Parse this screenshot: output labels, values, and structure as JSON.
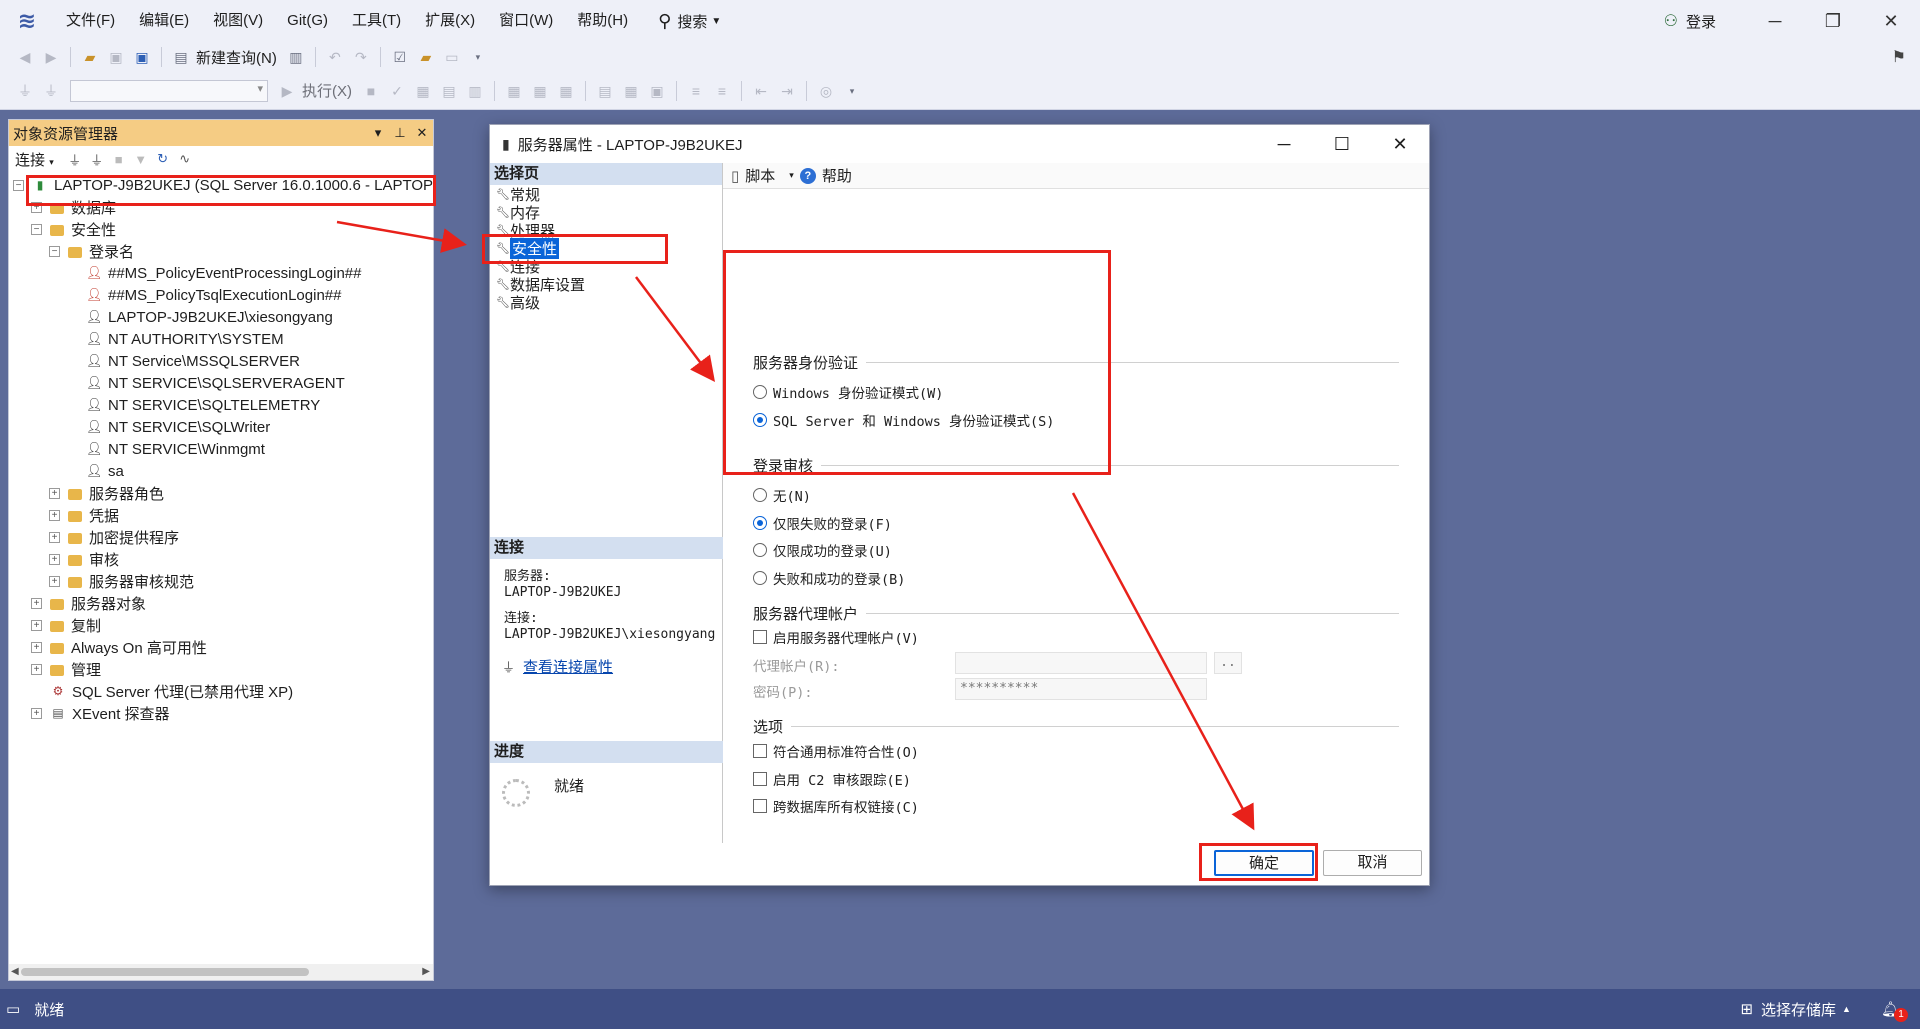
{
  "menubar": {
    "items": [
      "文件(F)",
      "编辑(E)",
      "视图(V)",
      "Git(G)",
      "工具(T)",
      "扩展(X)",
      "窗口(W)",
      "帮助(H)"
    ],
    "search_label": "搜索",
    "login_label": "登录"
  },
  "toolbar": {
    "new_query_label": "新建查询(N)",
    "execute_label": "执行(X)"
  },
  "object_explorer": {
    "title": "对象资源管理器",
    "connect_label": "连接",
    "tree": [
      {
        "level": 0,
        "expander": "−",
        "icon": "server-icon",
        "label": "LAPTOP-J9B2UKEJ (SQL Server 16.0.1000.6 - LAPTOP"
      },
      {
        "level": 1,
        "expander": "+",
        "icon": "folder-icon",
        "label": "数据库"
      },
      {
        "level": 1,
        "expander": "−",
        "icon": "folder-icon",
        "label": "安全性"
      },
      {
        "level": 2,
        "expander": "−",
        "icon": "folder-icon",
        "label": "登录名"
      },
      {
        "level": 3,
        "expander": "",
        "icon": "disabled-login-icon",
        "label": "##MS_PolicyEventProcessingLogin##"
      },
      {
        "level": 3,
        "expander": "",
        "icon": "disabled-login-icon",
        "label": "##MS_PolicyTsqlExecutionLogin##"
      },
      {
        "level": 3,
        "expander": "",
        "icon": "login-icon",
        "label": "LAPTOP-J9B2UKEJ\\xiesongyang"
      },
      {
        "level": 3,
        "expander": "",
        "icon": "login-icon",
        "label": "NT AUTHORITY\\SYSTEM"
      },
      {
        "level": 3,
        "expander": "",
        "icon": "login-icon",
        "label": "NT Service\\MSSQLSERVER"
      },
      {
        "level": 3,
        "expander": "",
        "icon": "login-icon",
        "label": "NT SERVICE\\SQLSERVERAGENT"
      },
      {
        "level": 3,
        "expander": "",
        "icon": "login-icon",
        "label": "NT SERVICE\\SQLTELEMETRY"
      },
      {
        "level": 3,
        "expander": "",
        "icon": "login-icon",
        "label": "NT SERVICE\\SQLWriter"
      },
      {
        "level": 3,
        "expander": "",
        "icon": "login-icon",
        "label": "NT SERVICE\\Winmgmt"
      },
      {
        "level": 3,
        "expander": "",
        "icon": "login-icon",
        "label": "sa"
      },
      {
        "level": 2,
        "expander": "+",
        "icon": "folder-icon",
        "label": "服务器角色"
      },
      {
        "level": 2,
        "expander": "+",
        "icon": "folder-icon",
        "label": "凭据"
      },
      {
        "level": 2,
        "expander": "+",
        "icon": "folder-icon",
        "label": "加密提供程序"
      },
      {
        "level": 2,
        "expander": "+",
        "icon": "folder-icon",
        "label": "审核"
      },
      {
        "level": 2,
        "expander": "+",
        "icon": "folder-icon",
        "label": "服务器审核规范"
      },
      {
        "level": 1,
        "expander": "+",
        "icon": "folder-icon",
        "label": "服务器对象"
      },
      {
        "level": 1,
        "expander": "+",
        "icon": "folder-icon",
        "label": "复制"
      },
      {
        "level": 1,
        "expander": "+",
        "icon": "folder-icon",
        "label": "Always On 高可用性"
      },
      {
        "level": 1,
        "expander": "+",
        "icon": "folder-icon",
        "label": "管理"
      },
      {
        "level": 1,
        "expander": "",
        "icon": "agent-icon",
        "label": "SQL Server 代理(已禁用代理 XP)"
      },
      {
        "level": 1,
        "expander": "+",
        "icon": "xevent-icon",
        "label": "XEvent 探查器"
      }
    ]
  },
  "dialog": {
    "title": "服务器属性 - LAPTOP-J9B2UKEJ",
    "select_page_header": "选择页",
    "pages": [
      "常规",
      "内存",
      "处理器",
      "安全性",
      "连接",
      "数据库设置",
      "高级"
    ],
    "selected_page": "安全性",
    "connection_header": "连接",
    "server_label": "服务器:",
    "server_value": "LAPTOP-J9B2UKEJ",
    "connection_label": "连接:",
    "connection_value": "LAPTOP-J9B2UKEJ\\xiesongyang",
    "view_connection_link": "查看连接属性",
    "progress_header": "进度",
    "progress_status": "就绪",
    "script_label": "脚本",
    "help_label": "帮助",
    "auth_group": "服务器身份验证",
    "auth_windows": "Windows 身份验证模式(W)",
    "auth_mixed": "SQL Server 和 Windows 身份验证模式(S)",
    "audit_group": "登录审核",
    "audit_none": "无(N)",
    "audit_failed": "仅限失败的登录(F)",
    "audit_success": "仅限成功的登录(U)",
    "audit_both": "失败和成功的登录(B)",
    "proxy_group": "服务器代理帐户",
    "proxy_enable": "启用服务器代理帐户(V)",
    "proxy_account_label": "代理帐户(R):",
    "proxy_account_value": "",
    "proxy_browse": "..",
    "password_label": "密码(P):",
    "password_value": "**********",
    "options_group": "选项",
    "opt_common_criteria": "符合通用标准符合性(O)",
    "opt_c2_audit": "启用 C2 审核跟踪(E)",
    "opt_cross_db": "跨数据库所有权链接(C)",
    "ok_label": "确定",
    "cancel_label": "取消"
  },
  "statusbar": {
    "status": "就绪",
    "repo_label": "选择存储库",
    "notification_count": "1"
  },
  "colors": {
    "accent": "#0a64d8",
    "annotation_red": "#e8211a",
    "panel_title": "#f5cc84",
    "statusbar": "#3f4f85"
  }
}
